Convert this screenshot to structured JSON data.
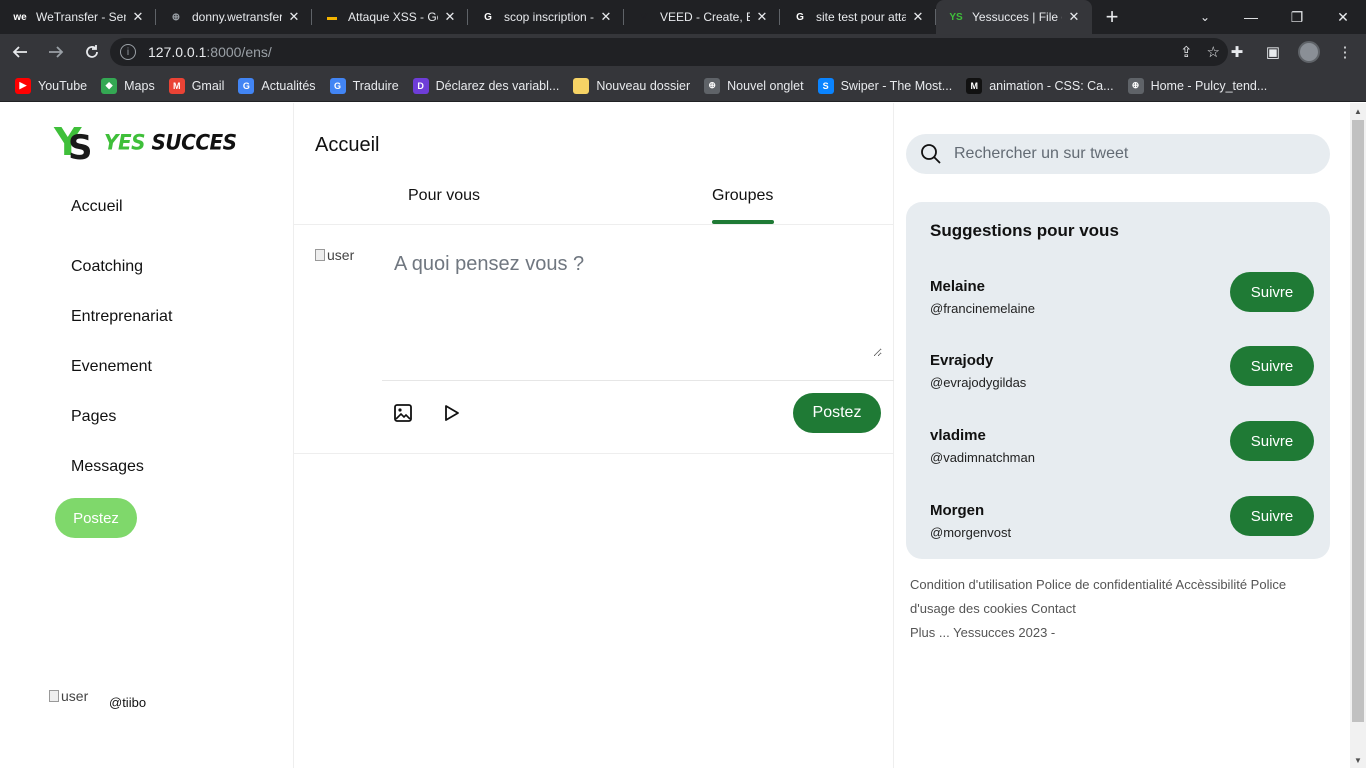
{
  "browser": {
    "tabs": [
      {
        "title": "WeTransfer - Send",
        "icon": "wetransfer-icon",
        "color": "#ffffff",
        "fav": "we"
      },
      {
        "title": "donny.wetransfer",
        "icon": "globe-icon",
        "color": "#9aa0a6",
        "fav": "⊕"
      },
      {
        "title": "Attaque XSS - Go",
        "icon": "slides-icon",
        "color": "#f4b400",
        "fav": "▬"
      },
      {
        "title": "scop inscription -",
        "icon": "google-icon",
        "color": "#ffffff",
        "fav": "G"
      },
      {
        "title": "VEED - Create, Ed",
        "icon": "veed-icon",
        "color": "#202124",
        "fav": "V"
      },
      {
        "title": "site test pour atta",
        "icon": "google-icon",
        "color": "#ffffff",
        "fav": "G"
      },
      {
        "title": "Yessucces | File d",
        "icon": "yessucces-icon",
        "color": "#3fbf3a",
        "fav": "YS",
        "active": true
      }
    ],
    "close_glyph": "✕",
    "new_tab_glyph": "+",
    "url_host": "127.0.0.1",
    "url_path": ":8000/ens/",
    "bookmarks": [
      {
        "label": "YouTube",
        "icon": "youtube-icon",
        "color": "#ff0000",
        "fav": "▶"
      },
      {
        "label": "Maps",
        "icon": "maps-icon",
        "color": "#34a853",
        "fav": "◆"
      },
      {
        "label": "Gmail",
        "icon": "gmail-icon",
        "color": "#ea4335",
        "fav": "M"
      },
      {
        "label": "Actualités",
        "icon": "news-icon",
        "color": "#4285f4",
        "fav": "G"
      },
      {
        "label": "Traduire",
        "icon": "translate-icon",
        "color": "#4285f4",
        "fav": "G"
      },
      {
        "label": "Déclarez des variabl...",
        "icon": "d-icon",
        "color": "#6e3dd8",
        "fav": "D"
      },
      {
        "label": "Nouveau dossier",
        "icon": "folder-icon",
        "color": "#f6d365",
        "fav": ""
      },
      {
        "label": "Nouvel onglet",
        "icon": "globe-icon",
        "color": "#5f6368",
        "fav": "⊕"
      },
      {
        "label": "Swiper - The Most...",
        "icon": "swiper-icon",
        "color": "#0a84ff",
        "fav": "S"
      },
      {
        "label": "animation - CSS: Ca...",
        "icon": "mdn-icon",
        "color": "#111111",
        "fav": "M"
      },
      {
        "label": "Home - Pulcy_tend...",
        "icon": "globe-icon",
        "color": "#5f6368",
        "fav": "⊕"
      }
    ]
  },
  "brand": {
    "mark_y": "Y",
    "mark_s": "S",
    "word_green": "YES ",
    "word_dark": "SUCCES",
    "green": "#3fbf3a"
  },
  "sidebar": {
    "items": [
      "Accueil",
      "Coatching",
      "Entreprenariat",
      "Evenement",
      "Pages",
      "Messages"
    ],
    "post_label": "Postez",
    "avatar_alt": "user",
    "handle": "@tiibo"
  },
  "feed": {
    "title": "Accueil",
    "tabs": [
      "Pour vous",
      "Groupes"
    ],
    "active_tab": "Groupes",
    "avatar_alt": "user",
    "composer_placeholder": "A quoi pensez vous ?",
    "post_label": "Postez",
    "accent": "#1f7a35"
  },
  "right": {
    "search_placeholder": "Rechercher un sur tweet",
    "suggestions_title": "Suggestions pour vous",
    "suggestions": [
      {
        "name": "Melaine",
        "handle": "@francinemelaine",
        "button": "Suivre"
      },
      {
        "name": "Evrajody",
        "handle": "@evrajodygildas",
        "button": "Suivre"
      },
      {
        "name": "vladime",
        "handle": "@vadimnatchman",
        "button": "Suivre"
      },
      {
        "name": "Morgen",
        "handle": "@morgenvost",
        "button": "Suivre"
      }
    ],
    "footer_line1": "Condition d'utilisation Police de confidentialité Accèssibilité Police d'usage des cookies Contact",
    "footer_line2": "Plus ... Yessucces 2023 -"
  }
}
